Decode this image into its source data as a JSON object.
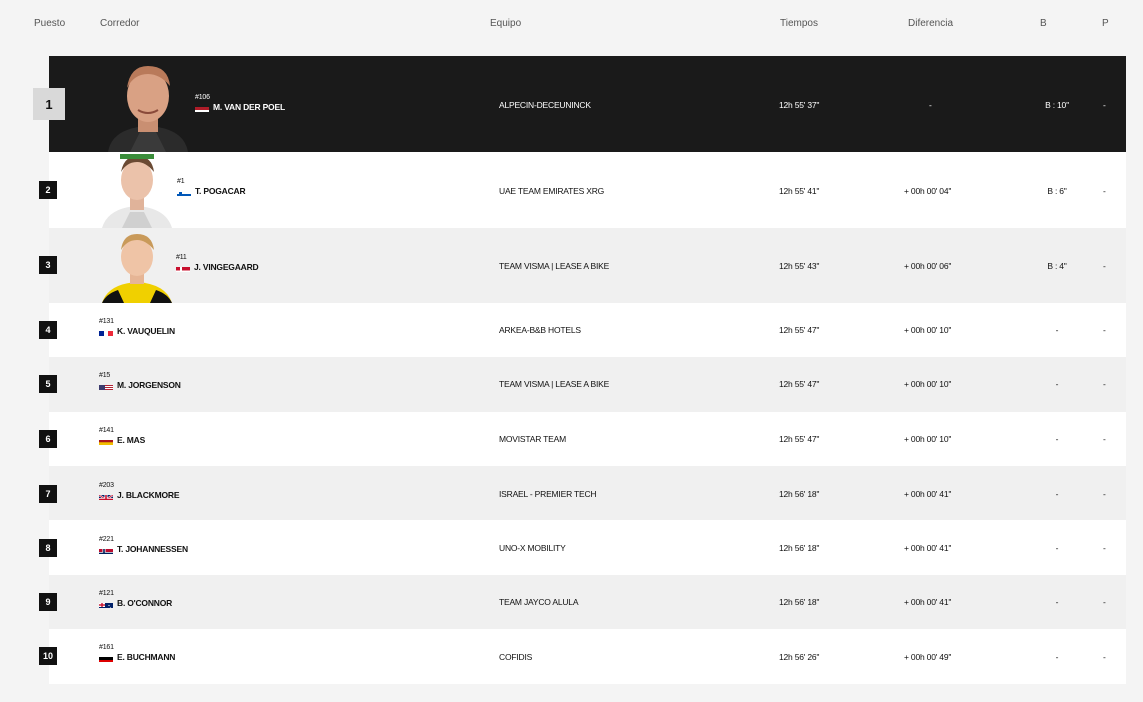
{
  "columns": {
    "puesto": "Puesto",
    "corredor": "Corredor",
    "equipo": "Equipo",
    "tiempos": "Tiempos",
    "diferencia": "Diferencia",
    "b": "B",
    "p": "P"
  },
  "rows": [
    {
      "rank": "1",
      "bib": "#106",
      "name": "M. VAN DER POEL",
      "flag": "netherlands",
      "team": "ALPECIN-DECEUNINCK",
      "time": "12h 55' 37''",
      "diff": "-",
      "b": "B : 10''",
      "p": "-"
    },
    {
      "rank": "2",
      "bib": "#1",
      "name": "T. POGACAR",
      "flag": "slovenia",
      "team": "UAE TEAM EMIRATES XRG",
      "time": "12h 55' 41''",
      "diff": "+ 00h 00' 04''",
      "b": "B : 6''",
      "p": "-"
    },
    {
      "rank": "3",
      "bib": "#11",
      "name": "J. VINGEGAARD",
      "flag": "denmark",
      "team": "TEAM VISMA | LEASE A BIKE",
      "time": "12h 55' 43''",
      "diff": "+ 00h 00' 06''",
      "b": "B : 4''",
      "p": "-"
    },
    {
      "rank": "4",
      "bib": "#131",
      "name": "K. VAUQUELIN",
      "flag": "france",
      "team": "ARKEA-B&B HOTELS",
      "time": "12h 55' 47''",
      "diff": "+ 00h 00' 10''",
      "b": "-",
      "p": "-"
    },
    {
      "rank": "5",
      "bib": "#15",
      "name": "M. JORGENSON",
      "flag": "usa",
      "team": "TEAM VISMA | LEASE A BIKE",
      "time": "12h 55' 47''",
      "diff": "+ 00h 00' 10''",
      "b": "-",
      "p": "-"
    },
    {
      "rank": "6",
      "bib": "#141",
      "name": "E. MAS",
      "flag": "spain",
      "team": "MOVISTAR TEAM",
      "time": "12h 55' 47''",
      "diff": "+ 00h 00' 10''",
      "b": "-",
      "p": "-"
    },
    {
      "rank": "7",
      "bib": "#203",
      "name": "J. BLACKMORE",
      "flag": "uk",
      "team": "ISRAEL - PREMIER TECH",
      "time": "12h 56' 18''",
      "diff": "+ 00h 00' 41''",
      "b": "-",
      "p": "-"
    },
    {
      "rank": "8",
      "bib": "#221",
      "name": "T. JOHANNESSEN",
      "flag": "norway",
      "team": "UNO-X MOBILITY",
      "time": "12h 56' 18''",
      "diff": "+ 00h 00' 41''",
      "b": "-",
      "p": "-"
    },
    {
      "rank": "9",
      "bib": "#121",
      "name": "B. O'CONNOR",
      "flag": "australia",
      "team": "TEAM JAYCO ALULA",
      "time": "12h 56' 18''",
      "diff": "+ 00h 00' 41''",
      "b": "-",
      "p": "-"
    },
    {
      "rank": "10",
      "bib": "#161",
      "name": "E. BUCHMANN",
      "flag": "germany",
      "team": "COFIDIS",
      "time": "12h 56' 26''",
      "diff": "+ 00h 00' 49''",
      "b": "-",
      "p": "-"
    }
  ]
}
